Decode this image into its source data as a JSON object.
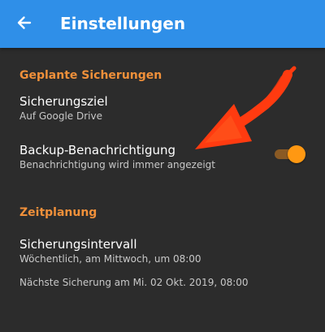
{
  "appbar": {
    "title": "Einstellungen",
    "back_icon": "arrow-left-icon",
    "background_color": "#2f8fe8"
  },
  "colors": {
    "background": "#2c2c2c",
    "accent": "#f0903a",
    "annotation": "#ff3b10"
  },
  "sections": [
    {
      "header": "Geplante Sicherungen",
      "items": [
        {
          "title": "Sicherungsziel",
          "summary": "Auf Google Drive"
        },
        {
          "title": "Backup-Benachrichtigung",
          "summary": "Benachrichtigung wird immer angezeigt",
          "toggle_on": true
        }
      ]
    },
    {
      "header": "Zeitplanung",
      "items": [
        {
          "title": "Sicherungsintervall",
          "summary": "Wöchentlich, am Mittwoch, um 08:00",
          "summary2": "Nächste Sicherung am Mi. 02 Okt. 2019, 08:00"
        }
      ]
    }
  ]
}
